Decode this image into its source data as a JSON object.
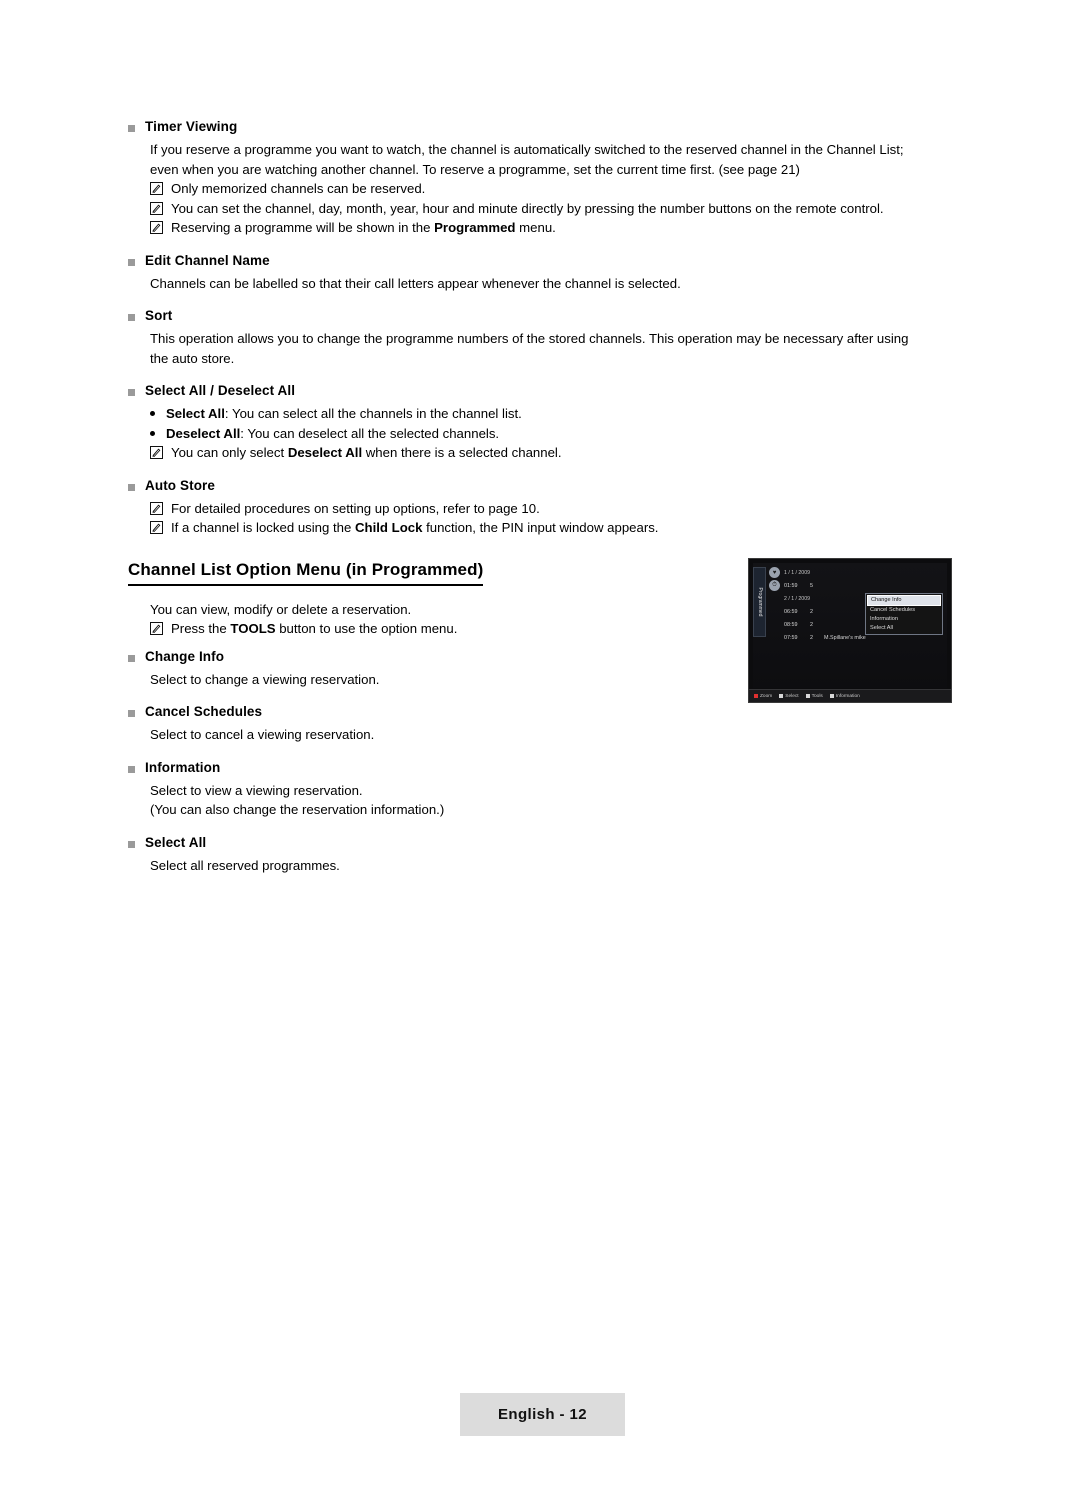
{
  "sections": [
    {
      "heading": "Timer Viewing",
      "paragraphs": [
        "If you reserve a programme you want to watch, the channel is automatically switched to the reserved channel in the Channel List;",
        "even when you are watching another channel. To reserve a programme, set the current time first. (see page 21)"
      ],
      "notes": [
        "Only memorized channels can be reserved.",
        "You can set the channel, day, month, year, hour and minute directly by pressing the number buttons on the remote control.",
        "Reserving a programme will be shown in the <b>Programmed</b> menu."
      ]
    },
    {
      "heading": "Edit Channel Name",
      "paragraphs": [
        "Channels can be labelled so that their call letters appear whenever the channel is selected."
      ],
      "notes": []
    },
    {
      "heading": "Sort",
      "paragraphs": [
        "This operation allows you to change the programme numbers of the stored channels. This operation may be necessary after using",
        "the auto store."
      ],
      "notes": []
    },
    {
      "heading": "Select All / Deselect All",
      "bullets": [
        "<b>Select All</b>: You can select all the channels in the channel list.",
        "<b>Deselect All</b>: You can deselect all the selected channels."
      ],
      "notes": [
        "You can only select <b>Deselect All</b> when there is a selected channel."
      ]
    },
    {
      "heading": "Auto Store",
      "notes": [
        "For detailed procedures on setting up options, refer to page 10.",
        "If a channel is locked using the <b>Child Lock</b> function, the PIN input window appears."
      ]
    }
  ],
  "channel_list_section": {
    "title": "Channel List Option Menu (in Programmed)",
    "intro": "You can view, modify or delete a reservation.",
    "intro_note": "Press the <b>TOOLS</b> button to use the option menu.",
    "items": [
      {
        "heading": "Change Info",
        "lines": [
          "Select to change a viewing reservation."
        ]
      },
      {
        "heading": "Cancel Schedules",
        "lines": [
          "Select to cancel a viewing reservation."
        ]
      },
      {
        "heading": "Information",
        "lines": [
          "Select to view a viewing reservation.",
          "(You can also change the reservation information.)"
        ]
      },
      {
        "heading": "Select All",
        "lines": [
          "Select all reserved programmes."
        ]
      }
    ]
  },
  "tv_screenshot": {
    "side_label": "Programmed",
    "rows": [
      {
        "type": "date",
        "text": "1 / 1 / 2009"
      },
      {
        "type": "entry",
        "time": "01:59",
        "num": "5",
        "name": "",
        "selected": false
      },
      {
        "type": "date",
        "text": "2 / 1 / 2009"
      },
      {
        "type": "entry",
        "time": "06:59",
        "num": "2",
        "name": "",
        "selected": false
      },
      {
        "type": "entry",
        "time": "08:59",
        "num": "2",
        "name": "",
        "selected": false
      },
      {
        "type": "entry",
        "time": "07:59",
        "num": "2",
        "name": "M.Spillane's mike",
        "selected": false
      }
    ],
    "menu": {
      "items": [
        "Change Info",
        "Cancel Schedules",
        "Information",
        "Select All"
      ],
      "active_index": 0
    },
    "footer_keys": [
      {
        "color": "#e03030",
        "label": "Zoom"
      },
      {
        "color": "#d8d8d8",
        "label": "Select"
      },
      {
        "color": "#d8d8d8",
        "label": "Tools"
      },
      {
        "color": "#d8d8d8",
        "label": "Information"
      }
    ]
  },
  "footer": {
    "page_label": "English - 12"
  }
}
